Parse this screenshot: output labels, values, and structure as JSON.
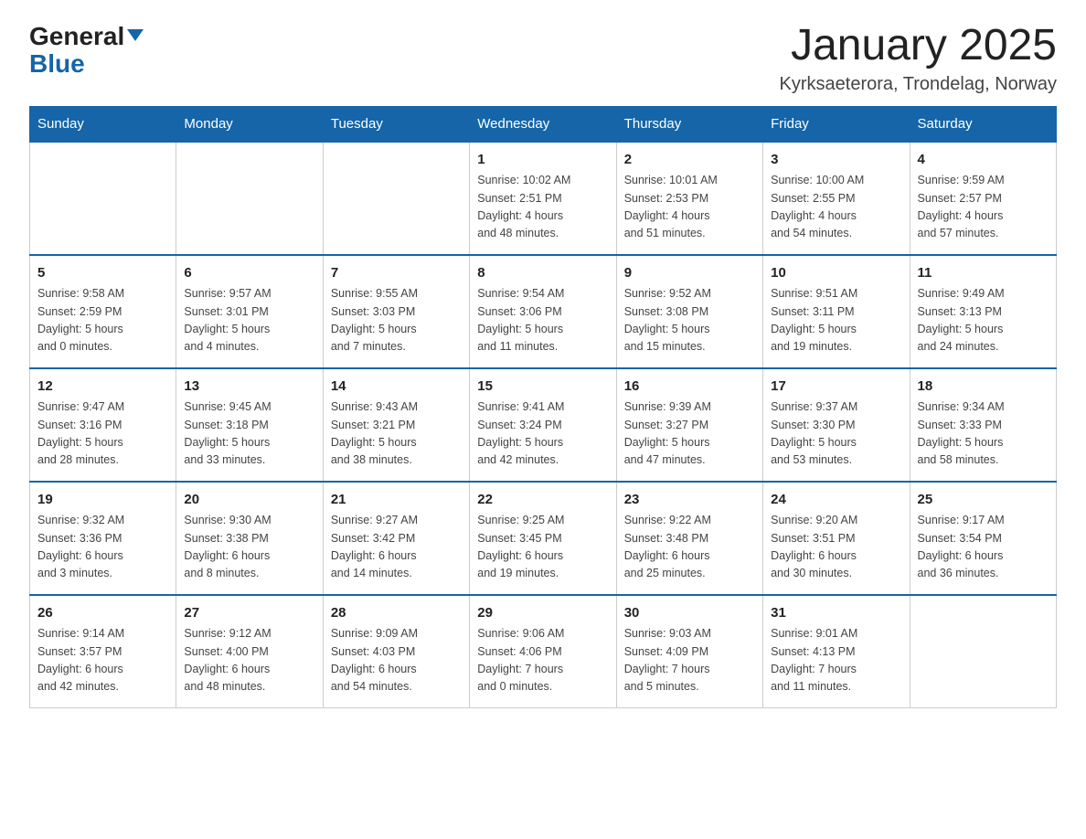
{
  "header": {
    "logo_general": "General",
    "logo_blue": "Blue",
    "title": "January 2025",
    "subtitle": "Kyrksaeterora, Trondelag, Norway"
  },
  "days_of_week": [
    "Sunday",
    "Monday",
    "Tuesday",
    "Wednesday",
    "Thursday",
    "Friday",
    "Saturday"
  ],
  "weeks": [
    [
      {
        "day": "",
        "info": ""
      },
      {
        "day": "",
        "info": ""
      },
      {
        "day": "",
        "info": ""
      },
      {
        "day": "1",
        "info": "Sunrise: 10:02 AM\nSunset: 2:51 PM\nDaylight: 4 hours\nand 48 minutes."
      },
      {
        "day": "2",
        "info": "Sunrise: 10:01 AM\nSunset: 2:53 PM\nDaylight: 4 hours\nand 51 minutes."
      },
      {
        "day": "3",
        "info": "Sunrise: 10:00 AM\nSunset: 2:55 PM\nDaylight: 4 hours\nand 54 minutes."
      },
      {
        "day": "4",
        "info": "Sunrise: 9:59 AM\nSunset: 2:57 PM\nDaylight: 4 hours\nand 57 minutes."
      }
    ],
    [
      {
        "day": "5",
        "info": "Sunrise: 9:58 AM\nSunset: 2:59 PM\nDaylight: 5 hours\nand 0 minutes."
      },
      {
        "day": "6",
        "info": "Sunrise: 9:57 AM\nSunset: 3:01 PM\nDaylight: 5 hours\nand 4 minutes."
      },
      {
        "day": "7",
        "info": "Sunrise: 9:55 AM\nSunset: 3:03 PM\nDaylight: 5 hours\nand 7 minutes."
      },
      {
        "day": "8",
        "info": "Sunrise: 9:54 AM\nSunset: 3:06 PM\nDaylight: 5 hours\nand 11 minutes."
      },
      {
        "day": "9",
        "info": "Sunrise: 9:52 AM\nSunset: 3:08 PM\nDaylight: 5 hours\nand 15 minutes."
      },
      {
        "day": "10",
        "info": "Sunrise: 9:51 AM\nSunset: 3:11 PM\nDaylight: 5 hours\nand 19 minutes."
      },
      {
        "day": "11",
        "info": "Sunrise: 9:49 AM\nSunset: 3:13 PM\nDaylight: 5 hours\nand 24 minutes."
      }
    ],
    [
      {
        "day": "12",
        "info": "Sunrise: 9:47 AM\nSunset: 3:16 PM\nDaylight: 5 hours\nand 28 minutes."
      },
      {
        "day": "13",
        "info": "Sunrise: 9:45 AM\nSunset: 3:18 PM\nDaylight: 5 hours\nand 33 minutes."
      },
      {
        "day": "14",
        "info": "Sunrise: 9:43 AM\nSunset: 3:21 PM\nDaylight: 5 hours\nand 38 minutes."
      },
      {
        "day": "15",
        "info": "Sunrise: 9:41 AM\nSunset: 3:24 PM\nDaylight: 5 hours\nand 42 minutes."
      },
      {
        "day": "16",
        "info": "Sunrise: 9:39 AM\nSunset: 3:27 PM\nDaylight: 5 hours\nand 47 minutes."
      },
      {
        "day": "17",
        "info": "Sunrise: 9:37 AM\nSunset: 3:30 PM\nDaylight: 5 hours\nand 53 minutes."
      },
      {
        "day": "18",
        "info": "Sunrise: 9:34 AM\nSunset: 3:33 PM\nDaylight: 5 hours\nand 58 minutes."
      }
    ],
    [
      {
        "day": "19",
        "info": "Sunrise: 9:32 AM\nSunset: 3:36 PM\nDaylight: 6 hours\nand 3 minutes."
      },
      {
        "day": "20",
        "info": "Sunrise: 9:30 AM\nSunset: 3:38 PM\nDaylight: 6 hours\nand 8 minutes."
      },
      {
        "day": "21",
        "info": "Sunrise: 9:27 AM\nSunset: 3:42 PM\nDaylight: 6 hours\nand 14 minutes."
      },
      {
        "day": "22",
        "info": "Sunrise: 9:25 AM\nSunset: 3:45 PM\nDaylight: 6 hours\nand 19 minutes."
      },
      {
        "day": "23",
        "info": "Sunrise: 9:22 AM\nSunset: 3:48 PM\nDaylight: 6 hours\nand 25 minutes."
      },
      {
        "day": "24",
        "info": "Sunrise: 9:20 AM\nSunset: 3:51 PM\nDaylight: 6 hours\nand 30 minutes."
      },
      {
        "day": "25",
        "info": "Sunrise: 9:17 AM\nSunset: 3:54 PM\nDaylight: 6 hours\nand 36 minutes."
      }
    ],
    [
      {
        "day": "26",
        "info": "Sunrise: 9:14 AM\nSunset: 3:57 PM\nDaylight: 6 hours\nand 42 minutes."
      },
      {
        "day": "27",
        "info": "Sunrise: 9:12 AM\nSunset: 4:00 PM\nDaylight: 6 hours\nand 48 minutes."
      },
      {
        "day": "28",
        "info": "Sunrise: 9:09 AM\nSunset: 4:03 PM\nDaylight: 6 hours\nand 54 minutes."
      },
      {
        "day": "29",
        "info": "Sunrise: 9:06 AM\nSunset: 4:06 PM\nDaylight: 7 hours\nand 0 minutes."
      },
      {
        "day": "30",
        "info": "Sunrise: 9:03 AM\nSunset: 4:09 PM\nDaylight: 7 hours\nand 5 minutes."
      },
      {
        "day": "31",
        "info": "Sunrise: 9:01 AM\nSunset: 4:13 PM\nDaylight: 7 hours\nand 11 minutes."
      },
      {
        "day": "",
        "info": ""
      }
    ]
  ]
}
